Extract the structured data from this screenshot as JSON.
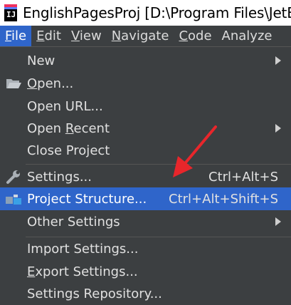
{
  "window": {
    "title": "EnglishPagesProj [D:\\Program Files\\JetBrains"
  },
  "menubar": {
    "items": [
      {
        "label": "File",
        "active": true
      },
      {
        "label": "Edit"
      },
      {
        "label": "View"
      },
      {
        "label": "Navigate"
      },
      {
        "label": "Code"
      },
      {
        "label": "Analyze"
      }
    ]
  },
  "file_menu": {
    "new": "New",
    "open": "Open...",
    "open_url": "Open URL...",
    "open_recent_pre": "Open ",
    "open_recent_mn": "R",
    "open_recent_post": "ecent",
    "close_project": "Close Project",
    "settings": "Settings...",
    "settings_shortcut": "Ctrl+Alt+S",
    "project_structure": "Project Structure...",
    "project_structure_shortcut": "Ctrl+Alt+Shift+S",
    "other_settings": "Other Settings",
    "import_settings": "Import Settings...",
    "export_settings": "Export Settings...",
    "settings_repository": "Settings Repository..."
  },
  "icons": {
    "app": "intellij-idea-icon",
    "open": "folder-open-icon",
    "settings": "wrench-icon",
    "project_structure": "project-structure-icon",
    "annotation": "red-arrow-icon"
  },
  "colors": {
    "menu_bg": "#3c3f41",
    "selection": "#2f65ca",
    "annotation_arrow": "#e8262b"
  }
}
